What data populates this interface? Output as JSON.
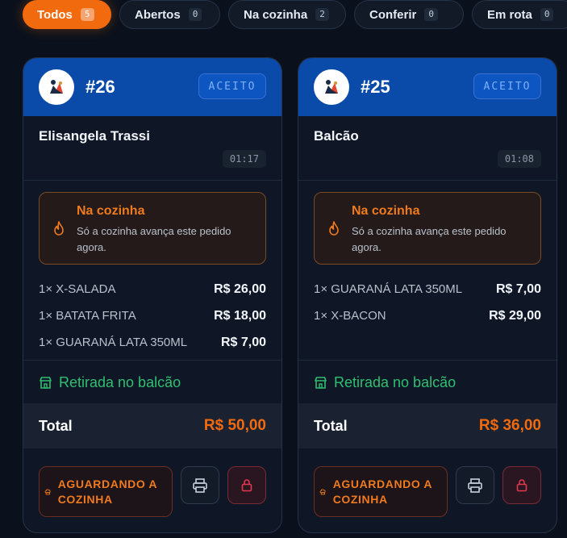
{
  "tabs": [
    {
      "label": "Todos",
      "count": "5",
      "active": true
    },
    {
      "label": "Abertos",
      "count": "0"
    },
    {
      "label": "Na cozinha",
      "count": "2"
    },
    {
      "label": "Conferir",
      "count": "0"
    },
    {
      "label": "Em rota",
      "count": "0"
    }
  ],
  "orders": [
    {
      "number": "#26",
      "status": "ACEITO",
      "customer": "Elisangela Trassi",
      "time": "01:17",
      "kitchen": {
        "title": "Na cozinha",
        "description": "Só a cozinha avança este pedido agora."
      },
      "items": [
        {
          "name": "1× X-SALADA",
          "price": "R$ 26,00"
        },
        {
          "name": "1× BATATA FRITA",
          "price": "R$ 18,00"
        },
        {
          "name": "1× GUARANÁ LATA 350ML",
          "price": "R$ 7,00"
        }
      ],
      "pickup": "Retirada no balcão",
      "total_label": "Total",
      "total": "R$ 50,00",
      "await_label": "AGUARDANDO A COZINHA"
    },
    {
      "number": "#25",
      "status": "ACEITO",
      "customer": "Balcão",
      "time": "01:08",
      "kitchen": {
        "title": "Na cozinha",
        "description": "Só a cozinha avança este pedido agora."
      },
      "items": [
        {
          "name": "1× GUARANÁ LATA 350ML",
          "price": "R$ 7,00"
        },
        {
          "name": "1× X-BACON",
          "price": "R$ 29,00"
        }
      ],
      "pickup": "Retirada no balcão",
      "total_label": "Total",
      "total": "R$ 36,00",
      "await_label": "AGUARDANDO A COZINHA"
    }
  ],
  "icons": {
    "kitchen": "flame-icon",
    "pickup": "store-icon",
    "await": "chef-hat-icon",
    "print": "printer-icon",
    "lock": "lock-icon",
    "logo": "restaurant-logo"
  },
  "colors": {
    "accent": "#f26a0e",
    "header_blue": "#0a4aa8",
    "pickup_green": "#2fbf71",
    "danger": "#e0384e"
  }
}
